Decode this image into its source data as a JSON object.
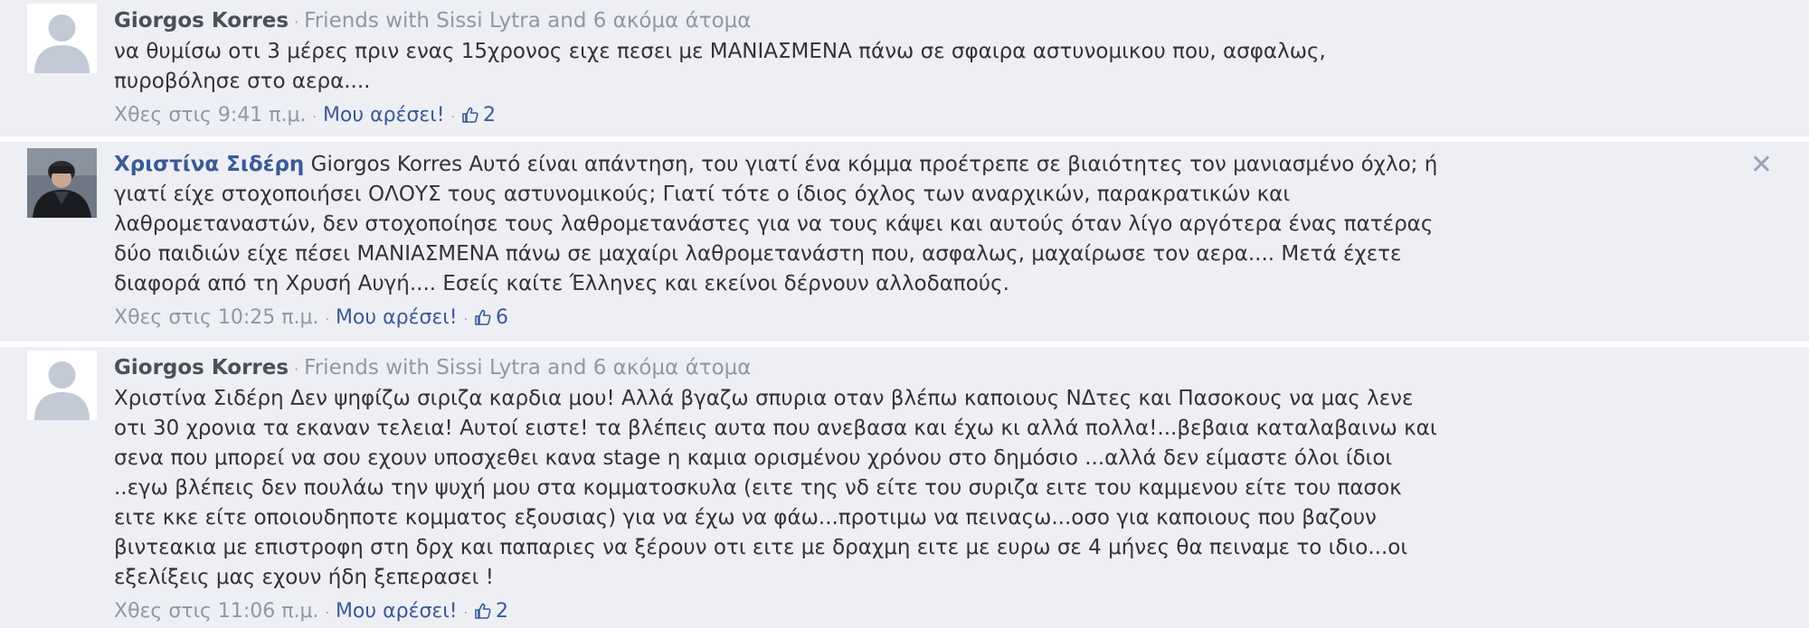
{
  "comments": [
    {
      "author": "Giorgos Korres",
      "friends": "Friends with Sissi Lytra and 6 ακόμα άτομα",
      "text": "να θυμίσω οτι 3 μέρες πριν ενας 15χρονος ειχε πεσει με ΜΑΝΙΑΣΜΕΝΑ πάνω σε σφαιρα αστυνομικου που, ασφαλως, πυροβόλησε στο αερα....",
      "time": "Χθες στις 9:41 π.μ.",
      "like_label": "Μου αρέσει!",
      "like_count": "2"
    },
    {
      "author": "Χριστίνα Σιδέρη",
      "friends": "",
      "text": "Giorgos Korres Αυτό είναι απάντηση, του γιατί ένα κόμμα προέτρεπε σε βιαιότητες τον μανιασμένο όχλο; ή γιατί είχε στοχοποιήσει ΟΛΟΥΣ τους αστυνομικούς; Γιατί τότε ο ίδιος όχλος των αναρχικών, παρακρατικών και λαθρομεταναστών, δεν στοχοποίησε τους λαθρομετανάστες για να τους κάψει και αυτούς όταν λίγο αργότερα ένας πατέρας δύο παιδιών είχε πέσει ΜΑΝΙΑΣΜΕΝΑ πάνω σε μαχαίρι λαθρομετανάστη που, ασφαλως, μαχαίρωσε τον αερα.... Μετά έχετε διαφορά από τη Χρυσή Αυγή.... Εσείς καίτε Έλληνες και εκείνοι δέρνουν αλλοδαπούς.",
      "time": "Χθες στις 10:25 π.μ.",
      "like_label": "Μου αρέσει!",
      "like_count": "6"
    },
    {
      "author": "Giorgos Korres",
      "friends": "Friends with Sissi Lytra and 6 ακόμα άτομα",
      "text": "Χριστίνα Σιδέρη Δεν ψηφίζω σιριζα καρδια μου! Αλλά βγαζω σπυρια οταν βλέπω καποιους ΝΔτες και Πασοκους να μας λενε οτι 30 χρονια τα εκαναν τελεια! Αυτοί ειστε! τα βλέπεις αυτα που ανεβασα και έχω κι αλλά πολλα!...βεβαια καταλαβαινω και σενα που μπορεί να σου εχουν υποσχεθει κανα stage η καμια ορισμένου χρόνου στο δημόσιο ...αλλά δεν είμαστε όλοι ίδιοι ..εγω βλέπεις δεν πουλάω την ψυχή μου στα κομματοσκυλα (ειτε της νδ είτε του συριζα ειτε του καμμενου είτε του πασοκ ειτε κκε είτε οποιουδηποτε κομματος εξουσιας) για να έχω να φάω...προτιμω να πειναςω...οσο για καποιους που βαζουν βιντεακια με επιστροφη στη δρχ και παπαριες να ξέρουν οτι ειτε με δραχμη ειτε με ευρω σε 4 μήνες θα πειναμε το ιδιο...οι εξελίξεις μας εχουν ήδη ξεπερασει !",
      "time": "Χθες στις 11:06 π.μ.",
      "like_label": "Μου αρέσει!",
      "like_count": "2"
    }
  ],
  "icons": {
    "close": "close-icon",
    "thumb": "thumbs-up-icon",
    "avatar_placeholder": "default-avatar-icon"
  },
  "colors": {
    "background": "#edeff4",
    "link": "#3b5998",
    "muted": "#9197a3"
  }
}
